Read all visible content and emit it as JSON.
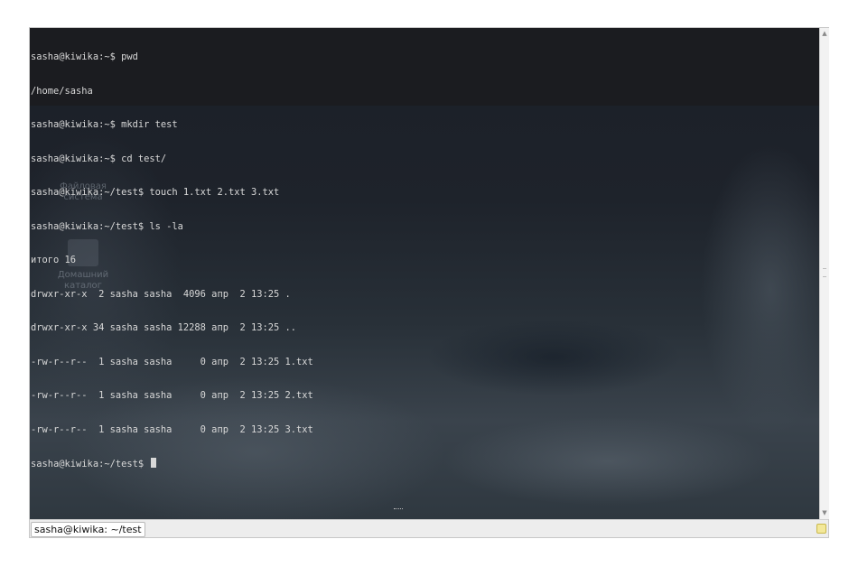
{
  "terminal": {
    "lines": [
      "sasha@kiwika:~$ pwd",
      "/home/sasha",
      "sasha@kiwika:~$ mkdir test",
      "sasha@kiwika:~$ cd test/",
      "sasha@kiwika:~/test$ touch 1.txt 2.txt 3.txt",
      "sasha@kiwika:~/test$ ls -la",
      "итого 16",
      "drwxr-xr-x  2 sasha sasha  4096 апр  2 13:25 .",
      "drwxr-xr-x 34 sasha sasha 12288 апр  2 13:25 ..",
      "-rw-r--r--  1 sasha sasha     0 апр  2 13:25 1.txt",
      "-rw-r--r--  1 sasha sasha     0 апр  2 13:25 2.txt",
      "-rw-r--r--  1 sasha sasha     0 апр  2 13:25 3.txt"
    ],
    "prompt": "sasha@kiwika:~/test$ "
  },
  "desktop": {
    "filesystem_label_1": "Файловая",
    "filesystem_label_2": "система",
    "home_label_1": "Домашний",
    "home_label_2": "каталог"
  },
  "tabbar": {
    "tab_title": "sasha@kiwika: ~/test"
  },
  "icons": {
    "scroll_up": "scroll-up-icon",
    "scroll_down": "scroll-down-icon",
    "resize": "resize-grip-icon"
  }
}
